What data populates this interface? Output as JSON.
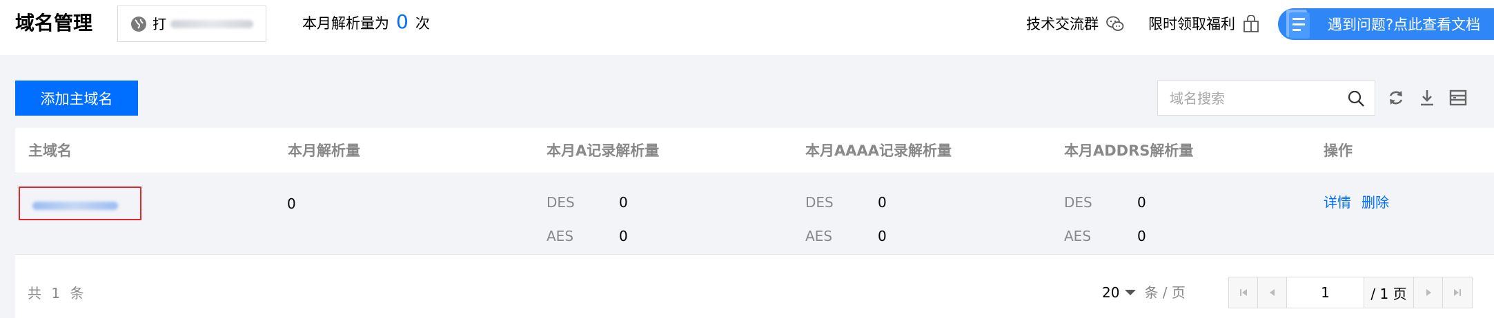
{
  "header": {
    "title": "域名管理",
    "account_prefix": "打",
    "monthly_prefix": "本月解析量为",
    "monthly_count": "0",
    "monthly_suffix": "次",
    "community_link": "技术交流群",
    "benefit_link": "限时领取福利",
    "help_button": "遇到问题?点此查看文档"
  },
  "toolbar": {
    "add_button": "添加主域名",
    "search_placeholder": "域名搜索",
    "icons": [
      "refresh-icon",
      "download-icon",
      "column-settings-icon"
    ]
  },
  "table": {
    "columns": [
      "主域名",
      "本月解析量",
      "本月A记录解析量",
      "本月AAAA记录解析量",
      "本月ADDRS解析量",
      "操作"
    ],
    "rows": [
      {
        "monthly_total": "0",
        "a_records": [
          {
            "label": "DES",
            "value": "0"
          },
          {
            "label": "AES",
            "value": "0"
          }
        ],
        "aaaa_records": [
          {
            "label": "DES",
            "value": "0"
          },
          {
            "label": "AES",
            "value": "0"
          }
        ],
        "addrs_records": [
          {
            "label": "DES",
            "value": "0"
          },
          {
            "label": "AES",
            "value": "0"
          }
        ],
        "actions": [
          "详情",
          "删除"
        ]
      }
    ]
  },
  "pagination": {
    "total_text": "共 1 条",
    "page_size": "20",
    "page_size_unit": "条 / 页",
    "current_page": "1",
    "total_pages": "/ 1 页"
  },
  "colors": {
    "primary": "#006eff",
    "highlight_border": "#e0262b"
  }
}
